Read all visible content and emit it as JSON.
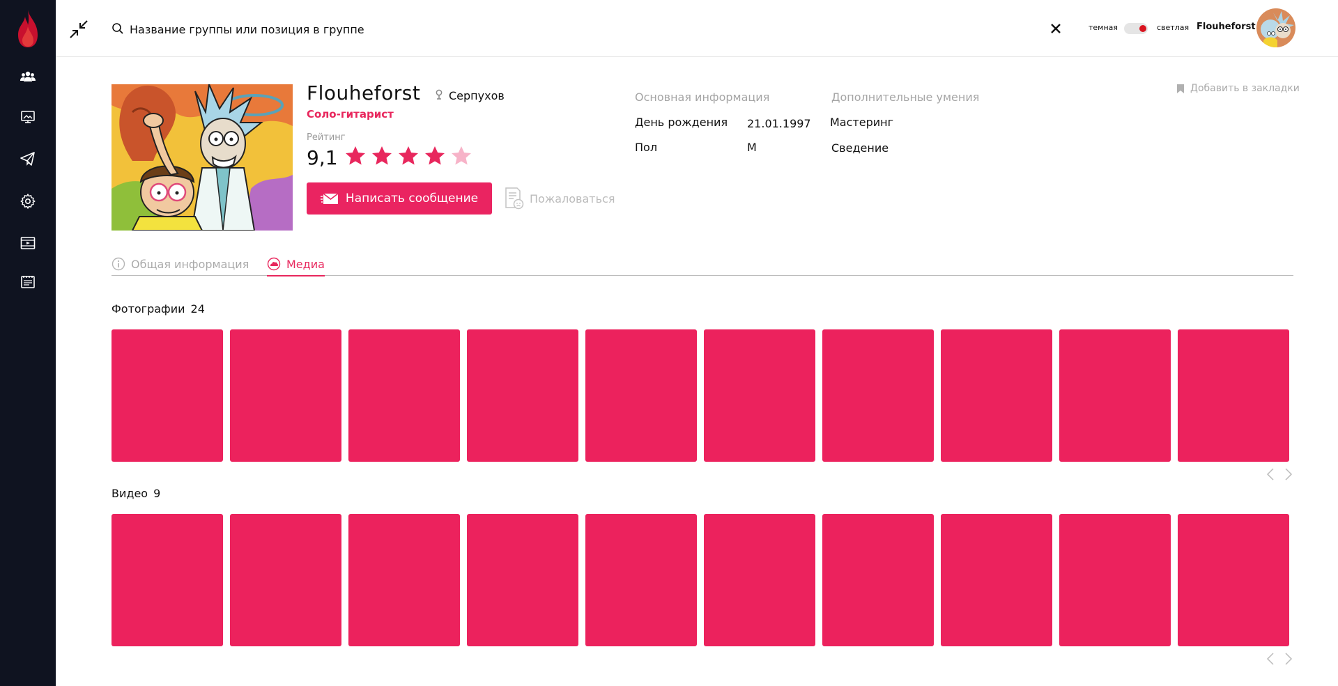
{
  "header": {
    "search_placeholder": "Название группы или позиция в группе",
    "theme_dark_label": "темная",
    "theme_light_label": "светлая",
    "user_name": "Flouheforst"
  },
  "profile": {
    "name": "Flouheforst",
    "location": "Серпухов",
    "role": "Соло-гитарист",
    "rating_label": "Рейтинг",
    "rating_value": "9,1",
    "rating_stars": 4,
    "rating_max": 5,
    "message_button": "Написать сообщение",
    "complain_label": "Пожаловаться",
    "bookmark_label": "Добавить в закладки"
  },
  "main_info": {
    "title": "Основная информация",
    "rows": [
      {
        "label": "День рождения",
        "value": "21.01.1997"
      },
      {
        "label": "Пол",
        "value": "М"
      }
    ]
  },
  "extra_skills": {
    "title": "Дополнительные умения",
    "items": [
      "Мастеринг",
      "Сведение"
    ]
  },
  "tabs": [
    {
      "label": "Общая информация",
      "active": false
    },
    {
      "label": "Медиа",
      "active": true
    }
  ],
  "media": {
    "photos": {
      "title": "Фотографии",
      "count": "24",
      "tiles": 10
    },
    "videos": {
      "title": "Видео",
      "count": "9",
      "tiles": 10
    }
  },
  "colors": {
    "accent": "#ea2461",
    "sidebar": "#0f1320",
    "toggle_knob": "#d9141f"
  }
}
